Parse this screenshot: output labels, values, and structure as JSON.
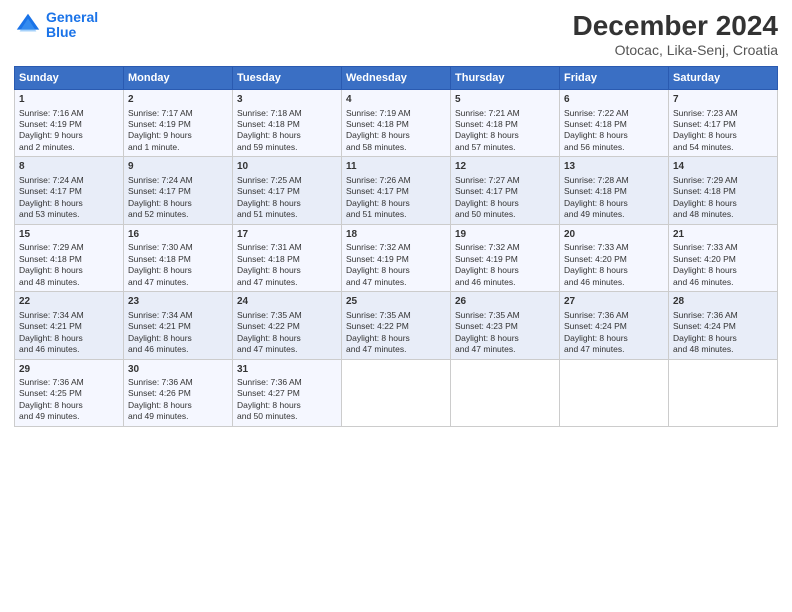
{
  "header": {
    "logo_line1": "General",
    "logo_line2": "Blue",
    "title": "December 2024",
    "subtitle": "Otocac, Lika-Senj, Croatia"
  },
  "days_of_week": [
    "Sunday",
    "Monday",
    "Tuesday",
    "Wednesday",
    "Thursday",
    "Friday",
    "Saturday"
  ],
  "weeks": [
    [
      {
        "day": "1",
        "lines": [
          "Sunrise: 7:16 AM",
          "Sunset: 4:19 PM",
          "Daylight: 9 hours",
          "and 2 minutes."
        ]
      },
      {
        "day": "2",
        "lines": [
          "Sunrise: 7:17 AM",
          "Sunset: 4:19 PM",
          "Daylight: 9 hours",
          "and 1 minute."
        ]
      },
      {
        "day": "3",
        "lines": [
          "Sunrise: 7:18 AM",
          "Sunset: 4:18 PM",
          "Daylight: 8 hours",
          "and 59 minutes."
        ]
      },
      {
        "day": "4",
        "lines": [
          "Sunrise: 7:19 AM",
          "Sunset: 4:18 PM",
          "Daylight: 8 hours",
          "and 58 minutes."
        ]
      },
      {
        "day": "5",
        "lines": [
          "Sunrise: 7:21 AM",
          "Sunset: 4:18 PM",
          "Daylight: 8 hours",
          "and 57 minutes."
        ]
      },
      {
        "day": "6",
        "lines": [
          "Sunrise: 7:22 AM",
          "Sunset: 4:18 PM",
          "Daylight: 8 hours",
          "and 56 minutes."
        ]
      },
      {
        "day": "7",
        "lines": [
          "Sunrise: 7:23 AM",
          "Sunset: 4:17 PM",
          "Daylight: 8 hours",
          "and 54 minutes."
        ]
      }
    ],
    [
      {
        "day": "8",
        "lines": [
          "Sunrise: 7:24 AM",
          "Sunset: 4:17 PM",
          "Daylight: 8 hours",
          "and 53 minutes."
        ]
      },
      {
        "day": "9",
        "lines": [
          "Sunrise: 7:24 AM",
          "Sunset: 4:17 PM",
          "Daylight: 8 hours",
          "and 52 minutes."
        ]
      },
      {
        "day": "10",
        "lines": [
          "Sunrise: 7:25 AM",
          "Sunset: 4:17 PM",
          "Daylight: 8 hours",
          "and 51 minutes."
        ]
      },
      {
        "day": "11",
        "lines": [
          "Sunrise: 7:26 AM",
          "Sunset: 4:17 PM",
          "Daylight: 8 hours",
          "and 51 minutes."
        ]
      },
      {
        "day": "12",
        "lines": [
          "Sunrise: 7:27 AM",
          "Sunset: 4:17 PM",
          "Daylight: 8 hours",
          "and 50 minutes."
        ]
      },
      {
        "day": "13",
        "lines": [
          "Sunrise: 7:28 AM",
          "Sunset: 4:18 PM",
          "Daylight: 8 hours",
          "and 49 minutes."
        ]
      },
      {
        "day": "14",
        "lines": [
          "Sunrise: 7:29 AM",
          "Sunset: 4:18 PM",
          "Daylight: 8 hours",
          "and 48 minutes."
        ]
      }
    ],
    [
      {
        "day": "15",
        "lines": [
          "Sunrise: 7:29 AM",
          "Sunset: 4:18 PM",
          "Daylight: 8 hours",
          "and 48 minutes."
        ]
      },
      {
        "day": "16",
        "lines": [
          "Sunrise: 7:30 AM",
          "Sunset: 4:18 PM",
          "Daylight: 8 hours",
          "and 47 minutes."
        ]
      },
      {
        "day": "17",
        "lines": [
          "Sunrise: 7:31 AM",
          "Sunset: 4:18 PM",
          "Daylight: 8 hours",
          "and 47 minutes."
        ]
      },
      {
        "day": "18",
        "lines": [
          "Sunrise: 7:32 AM",
          "Sunset: 4:19 PM",
          "Daylight: 8 hours",
          "and 47 minutes."
        ]
      },
      {
        "day": "19",
        "lines": [
          "Sunrise: 7:32 AM",
          "Sunset: 4:19 PM",
          "Daylight: 8 hours",
          "and 46 minutes."
        ]
      },
      {
        "day": "20",
        "lines": [
          "Sunrise: 7:33 AM",
          "Sunset: 4:20 PM",
          "Daylight: 8 hours",
          "and 46 minutes."
        ]
      },
      {
        "day": "21",
        "lines": [
          "Sunrise: 7:33 AM",
          "Sunset: 4:20 PM",
          "Daylight: 8 hours",
          "and 46 minutes."
        ]
      }
    ],
    [
      {
        "day": "22",
        "lines": [
          "Sunrise: 7:34 AM",
          "Sunset: 4:21 PM",
          "Daylight: 8 hours",
          "and 46 minutes."
        ]
      },
      {
        "day": "23",
        "lines": [
          "Sunrise: 7:34 AM",
          "Sunset: 4:21 PM",
          "Daylight: 8 hours",
          "and 46 minutes."
        ]
      },
      {
        "day": "24",
        "lines": [
          "Sunrise: 7:35 AM",
          "Sunset: 4:22 PM",
          "Daylight: 8 hours",
          "and 47 minutes."
        ]
      },
      {
        "day": "25",
        "lines": [
          "Sunrise: 7:35 AM",
          "Sunset: 4:22 PM",
          "Daylight: 8 hours",
          "and 47 minutes."
        ]
      },
      {
        "day": "26",
        "lines": [
          "Sunrise: 7:35 AM",
          "Sunset: 4:23 PM",
          "Daylight: 8 hours",
          "and 47 minutes."
        ]
      },
      {
        "day": "27",
        "lines": [
          "Sunrise: 7:36 AM",
          "Sunset: 4:24 PM",
          "Daylight: 8 hours",
          "and 47 minutes."
        ]
      },
      {
        "day": "28",
        "lines": [
          "Sunrise: 7:36 AM",
          "Sunset: 4:24 PM",
          "Daylight: 8 hours",
          "and 48 minutes."
        ]
      }
    ],
    [
      {
        "day": "29",
        "lines": [
          "Sunrise: 7:36 AM",
          "Sunset: 4:25 PM",
          "Daylight: 8 hours",
          "and 49 minutes."
        ]
      },
      {
        "day": "30",
        "lines": [
          "Sunrise: 7:36 AM",
          "Sunset: 4:26 PM",
          "Daylight: 8 hours",
          "and 49 minutes."
        ]
      },
      {
        "day": "31",
        "lines": [
          "Sunrise: 7:36 AM",
          "Sunset: 4:27 PM",
          "Daylight: 8 hours",
          "and 50 minutes."
        ]
      },
      null,
      null,
      null,
      null
    ]
  ]
}
